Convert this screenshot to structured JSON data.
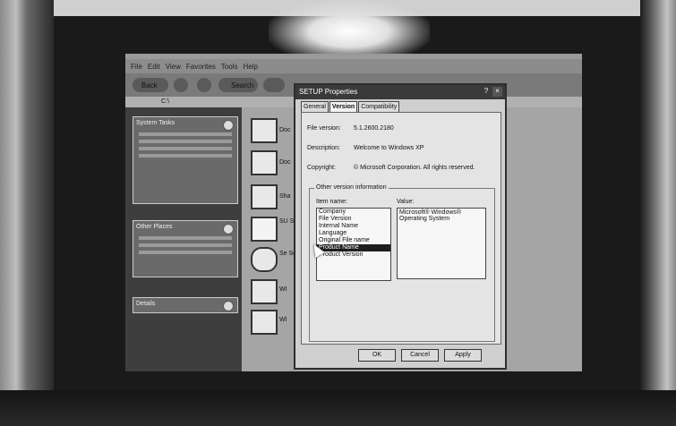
{
  "explorer": {
    "menu": [
      "File",
      "Edit",
      "View",
      "Favorites",
      "Tools",
      "Help"
    ],
    "toolbar": {
      "back": "Back",
      "search": "Search"
    },
    "address": "C:\\",
    "left_tasks": [
      {
        "title": "System Tasks"
      },
      {
        "title": "Other Places"
      },
      {
        "title": "Details"
      }
    ],
    "files": [
      {
        "label": "Doc"
      },
      {
        "label": "Doc"
      },
      {
        "label": "Sha"
      },
      {
        "label": "SU\nSe\nT"
      },
      {
        "label": "Se\nSe"
      },
      {
        "label": "WI"
      },
      {
        "label": "Wl"
      }
    ]
  },
  "dialog": {
    "title": "SETUP Properties",
    "help": "?",
    "close": "×",
    "tabs": [
      "General",
      "Version",
      "Compatibility"
    ],
    "active_tab": "Version",
    "fields": {
      "file_version_label": "File version:",
      "file_version": "5.1.2600.2180",
      "description_label": "Description:",
      "description": "Welcome to Windows XP",
      "copyright_label": "Copyright:",
      "copyright": "© Microsoft Corporation. All rights reserved."
    },
    "other_info_title": "Other version information",
    "item_name_label": "Item name:",
    "value_label": "Value:",
    "items": [
      "Company",
      "File Version",
      "Internal Name",
      "Language",
      "Original File name",
      "Product Name",
      "Product Version"
    ],
    "selected_item": "Product Name",
    "value": "Microsoft® Windows® Operating System",
    "buttons": [
      "OK",
      "Cancel",
      "Apply"
    ]
  }
}
